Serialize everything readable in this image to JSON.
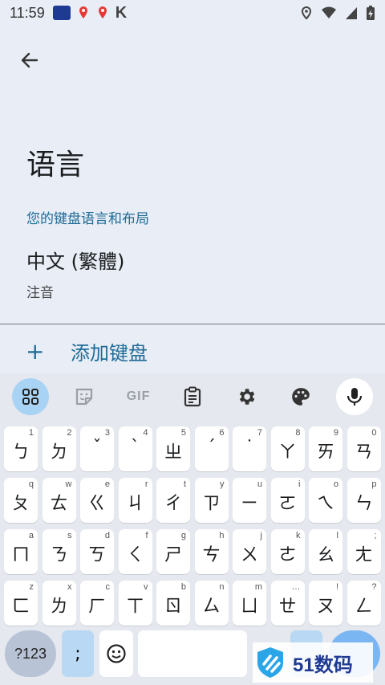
{
  "status_bar": {
    "time": "11:59",
    "k_label": "K"
  },
  "page": {
    "title": "语言",
    "section_title": "您的键盘语言和布局",
    "language_name": "中文 (繁體)",
    "language_layout": "注音",
    "add_keyboard_label": "添加键盘",
    "add_icon": "+"
  },
  "keyboard": {
    "toolbar": {
      "items": [
        {
          "icon": "apps-grid-icon",
          "active": true
        },
        {
          "icon": "sticker-icon"
        },
        {
          "icon": "gif-icon",
          "label": "GIF"
        },
        {
          "icon": "clipboard-icon"
        },
        {
          "icon": "settings-icon"
        },
        {
          "icon": "palette-icon"
        },
        {
          "icon": "mic-icon"
        }
      ]
    },
    "rows": [
      [
        {
          "main": "ㄅ",
          "hint": "1"
        },
        {
          "main": "ㄉ",
          "hint": "2"
        },
        {
          "main": "ˇ",
          "hint": "3"
        },
        {
          "main": "ˋ",
          "hint": "4"
        },
        {
          "main": "ㄓ",
          "hint": "5"
        },
        {
          "main": "ˊ",
          "hint": "6"
        },
        {
          "main": "˙",
          "hint": "7"
        },
        {
          "main": "ㄚ",
          "hint": "8"
        },
        {
          "main": "ㄞ",
          "hint": "9"
        },
        {
          "main": "ㄢ",
          "hint": "0"
        }
      ],
      [
        {
          "main": "ㄆ",
          "hint": "q"
        },
        {
          "main": "ㄊ",
          "hint": "w"
        },
        {
          "main": "ㄍ",
          "hint": "e"
        },
        {
          "main": "ㄐ",
          "hint": "r"
        },
        {
          "main": "ㄔ",
          "hint": "t"
        },
        {
          "main": "ㄗ",
          "hint": "y"
        },
        {
          "main": "ㄧ",
          "hint": "u"
        },
        {
          "main": "ㄛ",
          "hint": "i"
        },
        {
          "main": "ㄟ",
          "hint": "o"
        },
        {
          "main": "ㄣ",
          "hint": "p"
        }
      ],
      [
        {
          "main": "ㄇ",
          "hint": "a"
        },
        {
          "main": "ㄋ",
          "hint": "s"
        },
        {
          "main": "ㄎ",
          "hint": "d"
        },
        {
          "main": "ㄑ",
          "hint": "f"
        },
        {
          "main": "ㄕ",
          "hint": "g"
        },
        {
          "main": "ㄘ",
          "hint": "h"
        },
        {
          "main": "ㄨ",
          "hint": "j"
        },
        {
          "main": "ㄜ",
          "hint": "k"
        },
        {
          "main": "ㄠ",
          "hint": "l"
        },
        {
          "main": "ㄤ",
          "hint": ";"
        }
      ],
      [
        {
          "main": "ㄈ",
          "hint": "z"
        },
        {
          "main": "ㄌ",
          "hint": "x"
        },
        {
          "main": "ㄏ",
          "hint": "c"
        },
        {
          "main": "ㄒ",
          "hint": "v"
        },
        {
          "main": "ㄖ",
          "hint": "b"
        },
        {
          "main": "ㄙ",
          "hint": "n"
        },
        {
          "main": "ㄩ",
          "hint": "m"
        },
        {
          "main": "ㄝ",
          "hint": "…"
        },
        {
          "main": "ㄡ",
          "hint": "!"
        },
        {
          "main": "ㄥ",
          "hint": "?"
        }
      ]
    ],
    "bottom": {
      "symbols_label": "?123",
      "semicolon_label": ";"
    }
  },
  "watermark": {
    "text": "51数码"
  },
  "colors": {
    "background": "#e8edf6",
    "accent": "#1f6b96",
    "keyboard_bg": "#e5e8ee",
    "key_bg": "#ffffff",
    "active_toolbar": "#a9d3f4"
  }
}
